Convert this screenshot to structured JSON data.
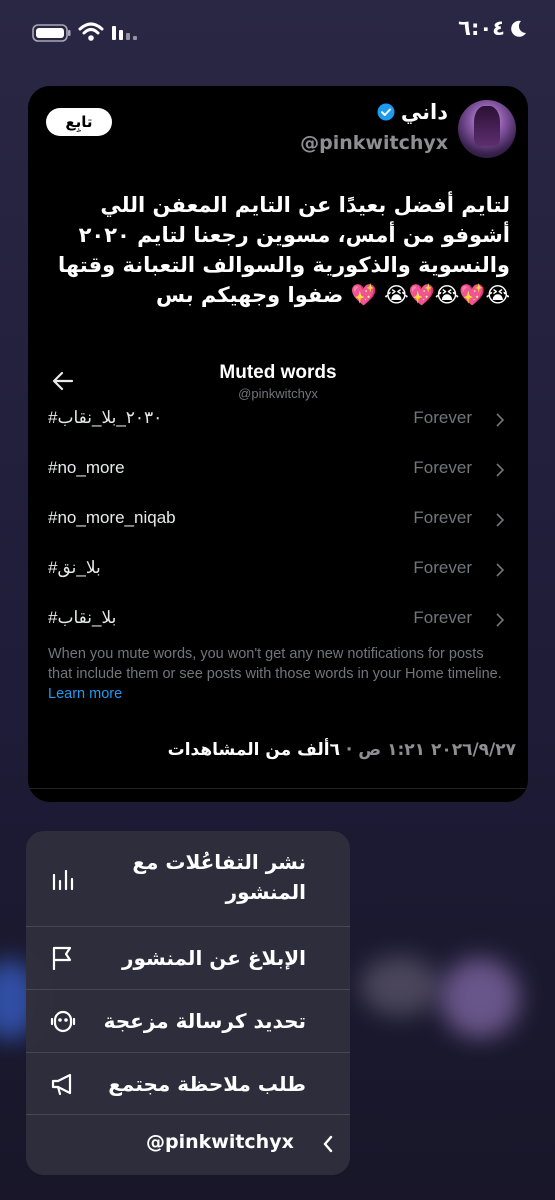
{
  "status_bar": {
    "time": "٦:٠٤"
  },
  "post": {
    "display_name": "داني",
    "handle": "@pinkwitchyx",
    "follow_label": "تابِع",
    "text": "لتايم أفضل بعيدًا عن التايم المعفن اللي أشوفو من أمس، مسوين رجعنا لتايم ٢٠٢٠ والنسوية والذكورية والسوالف التعبانة وقتها😭💖😭💖😭 💖 ضفوا وجهيكم بس",
    "timestamp_date": "٢٠٢٦/٩/٢٧",
    "timestamp_time": "١:٢١ ص",
    "views_count": "٦ألف",
    "views_label": "من المشاهدات",
    "separator": "·"
  },
  "embed": {
    "title": "Muted words",
    "subtitle": "@pinkwitchyx",
    "rows": [
      {
        "word": "#٢٠٣٠_بلا_نقاب",
        "duration": "Forever"
      },
      {
        "word": "#no_more",
        "duration": "Forever"
      },
      {
        "word": "#no_more_niqab",
        "duration": "Forever"
      },
      {
        "word": "#بلا_نق",
        "duration": "Forever"
      },
      {
        "word": "#بلا_نقاب",
        "duration": "Forever"
      }
    ],
    "note": "When you mute words, you won't get any new notifications for posts that include them or see posts with those words in your Home timeline.",
    "learn_more": "Learn more"
  },
  "menu": {
    "items": [
      {
        "label": "نشر التفاعُلات مع المنشور",
        "icon": "chart-bars-icon"
      },
      {
        "label": "الإبلاغ عن المنشور",
        "icon": "flag-icon"
      },
      {
        "label": "تحديد كرسالة مزعجة",
        "icon": "robot-icon"
      },
      {
        "label": "طلب ملاحظة مجتمع",
        "icon": "megaphone-icon"
      }
    ],
    "footer_handle": "@pinkwitchyx"
  },
  "colors": {
    "background": "#221f3c",
    "card": "#000000",
    "menu": "#302e3c",
    "link": "#1d9bf0",
    "verified": "#1d9bf0"
  }
}
